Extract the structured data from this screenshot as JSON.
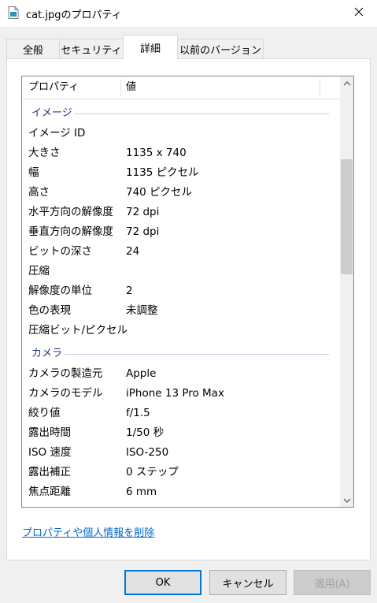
{
  "window": {
    "title": "cat.jpgのプロパティ"
  },
  "tabs": [
    {
      "label": "全般"
    },
    {
      "label": "セキュリティ"
    },
    {
      "label": "詳細"
    },
    {
      "label": "以前のバージョン"
    }
  ],
  "list": {
    "headers": {
      "property": "プロパティ",
      "value": "値"
    },
    "groups": {
      "image": "イメージ",
      "camera": "カメラ"
    },
    "image_rows": [
      {
        "k": "イメージ ID",
        "v": ""
      },
      {
        "k": "大きさ",
        "v": "1135 x 740"
      },
      {
        "k": "幅",
        "v": "1135 ピクセル"
      },
      {
        "k": "高さ",
        "v": "740 ピクセル"
      },
      {
        "k": "水平方向の解像度",
        "v": "72 dpi"
      },
      {
        "k": "垂直方向の解像度",
        "v": "72 dpi"
      },
      {
        "k": "ビットの深さ",
        "v": "24"
      },
      {
        "k": "圧縮",
        "v": ""
      },
      {
        "k": "解像度の単位",
        "v": "2"
      },
      {
        "k": "色の表現",
        "v": "未調整"
      },
      {
        "k": "圧縮ビット/ピクセル",
        "v": ""
      }
    ],
    "camera_rows": [
      {
        "k": "カメラの製造元",
        "v": "Apple"
      },
      {
        "k": "カメラのモデル",
        "v": "iPhone 13 Pro Max"
      },
      {
        "k": "絞り値",
        "v": "f/1.5"
      },
      {
        "k": "露出時間",
        "v": "1/50 秒"
      },
      {
        "k": "ISO 速度",
        "v": "ISO-250"
      },
      {
        "k": "露出補正",
        "v": "0 ステップ"
      },
      {
        "k": "焦点距離",
        "v": "6 mm"
      }
    ]
  },
  "remove_link": "プロパティや個人情報を削除",
  "buttons": {
    "ok": "OK",
    "cancel": "キャンセル",
    "apply": "適用(A)"
  },
  "colors": {
    "accent": "#0078d7",
    "group_text": "#1e3287",
    "link": "#0066cc"
  },
  "icons": {
    "window": "image-file-icon",
    "close": "close-icon",
    "up": "chevron-up-icon",
    "down": "chevron-down-icon"
  }
}
